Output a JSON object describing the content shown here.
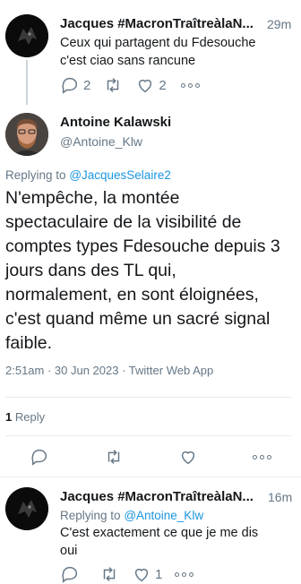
{
  "tweets": [
    {
      "name": "Jacques #MacronTraîtreàlaN...",
      "time": "29m",
      "text_lines": [
        "Ceux qui partagent du Fdesouche",
        "c'est ciao sans rancune"
      ],
      "reply_count": "2",
      "like_count": "2"
    }
  ],
  "main_tweet": {
    "name": "Antoine Kalawski",
    "handle": "@Antoine_Klw",
    "replying_to_label": "Replying to",
    "replying_to_handle": "@JacquesSelaire2",
    "text_lines": [
      "N'empêche, la montée",
      "spectaculaire de la visibilité de",
      "comptes types Fdesouche depuis 3",
      "jours dans des TL qui,",
      "normalement, en sont éloignées,",
      "c'est quand même un sacré signal",
      "faible."
    ],
    "meta": "2:51am · 30 Jun 2023 · Twitter Web App",
    "reply_count": "1",
    "reply_label": "Reply"
  },
  "reply_tweet": {
    "name": "Jacques #MacronTraîtreàlaN...",
    "time": "16m",
    "replying_to_label": "Replying to",
    "replying_to_handle": "@Antoine_Klw",
    "text_lines": [
      "C'est exactement ce que je me dis",
      "oui"
    ],
    "like_count": "1"
  },
  "colors": {
    "link": "#1b95e0",
    "muted": "#657786",
    "divider": "#e6ecf0"
  },
  "icons": [
    "reply-icon",
    "retweet-icon",
    "like-icon",
    "more-icon",
    "dark-avatar-icon"
  ]
}
